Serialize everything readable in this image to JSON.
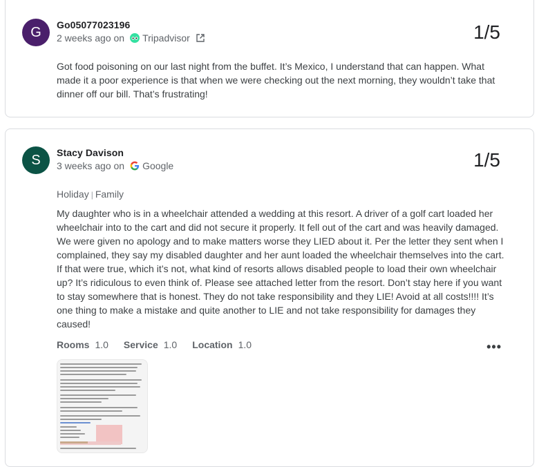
{
  "reviews": [
    {
      "initial": "G",
      "avatar_color": "#4a1f6b",
      "author": "Go05077023196",
      "time": "2 weeks ago on",
      "source": "Tripadvisor",
      "source_icon": "tripadvisor-icon",
      "score": "1/5",
      "text": "Got food poisoning on our last night from the buffet. It’s Mexico, I understand that can happen. What made it a poor experience is that when we were checking out the next morning, they wouldn’t take that dinner off our bill. That’s frustrating!"
    },
    {
      "initial": "S",
      "avatar_color": "#0b5345",
      "author": "Stacy Davison",
      "time": "3 weeks ago on",
      "source": "Google",
      "source_icon": "google-icon",
      "score": "1/5",
      "tags": [
        "Holiday",
        "Family"
      ],
      "tag_separator": "|",
      "text": "My daughter who is in a wheelchair attended a wedding at this resort. A driver of a golf cart loaded her wheelchair into to the cart and did not secure it properly. It fell out of the cart and was heavily damaged. We were given no apology and to make matters worse they LIED about it. Per the letter they sent when I complained, they say my disabled daughter and her aunt loaded the wheelchair themselves into the cart. If that were true, which it’s not, what kind of resorts allows disabled people to load their own wheelchair up? It’s ridiculous to even think of. Please see attached letter from the resort. Don’t stay here if you want to stay somewhere that is honest. They do not take responsibility and they LIE! Avoid at all costs!!!! It’s one thing to make a mistake and quite another to LIE and not take responsibility for damages they caused!",
      "ratings": [
        {
          "label": "Rooms",
          "value": "1.0"
        },
        {
          "label": "Service",
          "value": "1.0"
        },
        {
          "label": "Location",
          "value": "1.0"
        }
      ],
      "more_label": "•••",
      "photo": "attached-letter-photo"
    }
  ],
  "colors": {
    "tripadvisor": "#34e0a1",
    "google_blue": "#4285f4",
    "google_red": "#ea4335",
    "google_yellow": "#fbbc05",
    "google_green": "#34a853"
  }
}
